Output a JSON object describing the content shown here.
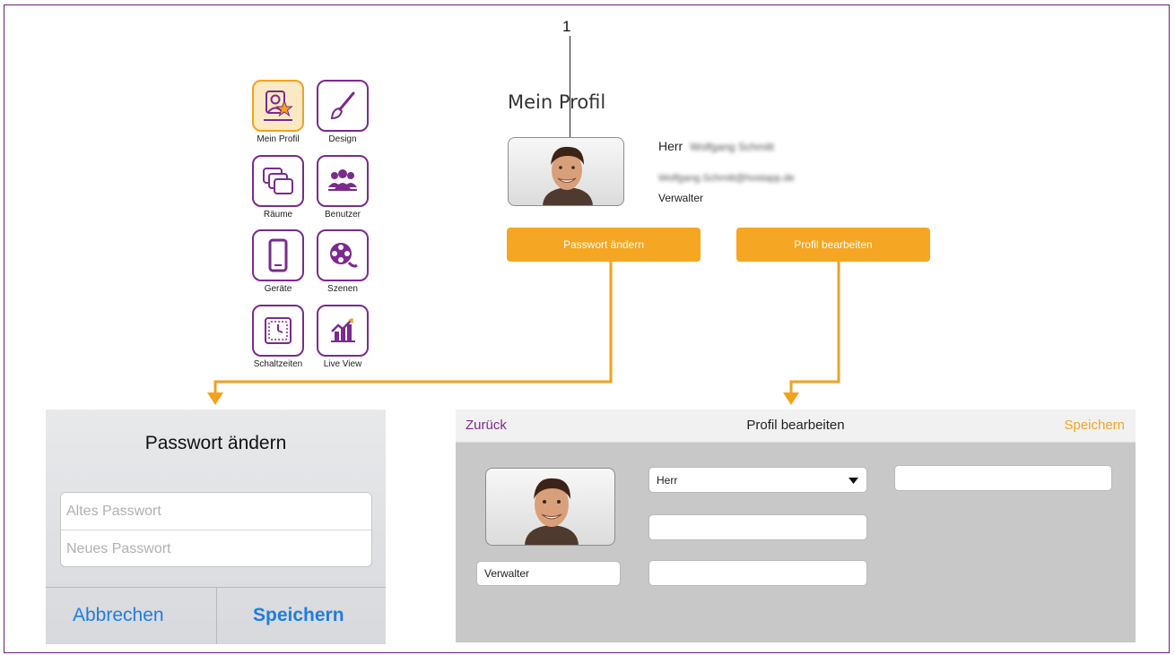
{
  "callout": {
    "number": "1"
  },
  "menu": {
    "items": [
      {
        "label": "Mein Profil",
        "icon": "profile-star-icon",
        "active": true
      },
      {
        "label": "Design",
        "icon": "brush-icon"
      },
      {
        "label": "Räume",
        "icon": "rooms-icon"
      },
      {
        "label": "Benutzer",
        "icon": "users-icon"
      },
      {
        "label": "Geräte",
        "icon": "phone-icon"
      },
      {
        "label": "Szenen",
        "icon": "film-reel-icon"
      },
      {
        "label": "Schaltzeiten",
        "icon": "clock-icon"
      },
      {
        "label": "Live View",
        "icon": "chart-icon"
      }
    ]
  },
  "profile": {
    "title": "Mein Profil",
    "salutation": "Herr",
    "name": "Wolfgang Schmitt",
    "email": "Wolfgang.Schmitt@hostapp.de",
    "role": "Verwalter",
    "change_password_label": "Passwort ändern",
    "edit_profile_label": "Profil bearbeiten"
  },
  "password_dialog": {
    "title": "Passwort ändern",
    "old_placeholder": "Altes Passwort",
    "new_placeholder": "Neues Passwort",
    "cancel_label": "Abbrechen",
    "save_label": "Speichern"
  },
  "edit_panel": {
    "back_label": "Zurück",
    "title": "Profil bearbeiten",
    "save_label": "Speichern",
    "salutation_value": "Herr",
    "role_value": "Verwalter"
  },
  "colors": {
    "accent": "#f5a623",
    "purple": "#7b2a8e",
    "ios_blue": "#1f7de0"
  }
}
